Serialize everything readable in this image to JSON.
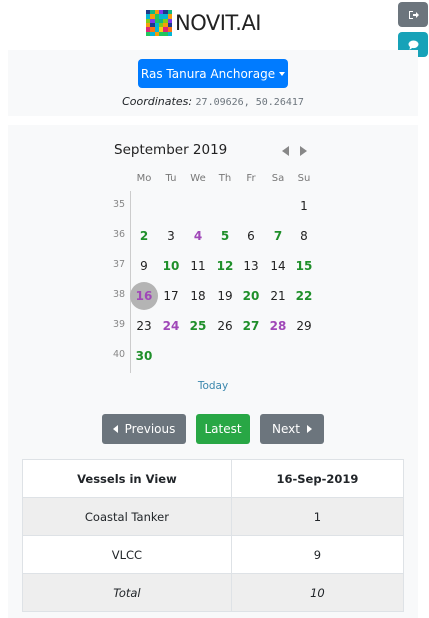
{
  "brand": {
    "name": "NOVIT.AI"
  },
  "topbar": {
    "logout_icon": "sign-out-icon",
    "chat_icon": "comment-icon"
  },
  "location": {
    "selected": "Ras Tanura Anchorage",
    "coordinates_label": "Coordinates:",
    "coordinates_value": "27.09626, 50.26417"
  },
  "calendar": {
    "month_title": "September 2019",
    "weekdays": [
      "Mo",
      "Tu",
      "We",
      "Th",
      "Fr",
      "Sa",
      "Su"
    ],
    "week_numbers": [
      "35",
      "36",
      "37",
      "38",
      "39",
      "40"
    ],
    "weeks": [
      [
        null,
        null,
        null,
        null,
        null,
        null,
        "1"
      ],
      [
        "2",
        "3",
        "4",
        "5",
        "6",
        "7",
        "8"
      ],
      [
        "9",
        "10",
        "11",
        "12",
        "13",
        "14",
        "15"
      ],
      [
        "16",
        "17",
        "18",
        "19",
        "20",
        "21",
        "22"
      ],
      [
        "23",
        "24",
        "25",
        "26",
        "27",
        "28",
        "29"
      ],
      [
        "30",
        null,
        null,
        null,
        null,
        null,
        null
      ]
    ],
    "green_days": [
      "2",
      "5",
      "7",
      "10",
      "12",
      "15",
      "20",
      "22",
      "25",
      "27",
      "30"
    ],
    "purple_days": [
      "4",
      "16",
      "24",
      "28"
    ],
    "selected_day": "16",
    "today_label": "Today"
  },
  "navigation": {
    "previous_label": "Previous",
    "latest_label": "Latest",
    "next_label": "Next"
  },
  "table": {
    "headers": [
      "Vessels in View",
      "16-Sep-2019"
    ],
    "rows": [
      [
        "Coastal Tanker",
        "1"
      ],
      [
        "VLCC",
        "9"
      ]
    ],
    "total": [
      "Total",
      "10"
    ]
  },
  "colors": {
    "primary": "#007bff",
    "secondary": "#6c757d",
    "success": "#28a745",
    "info": "#17a2b8",
    "day_green": "#1f8f2a",
    "day_purple": "#a048b8"
  }
}
